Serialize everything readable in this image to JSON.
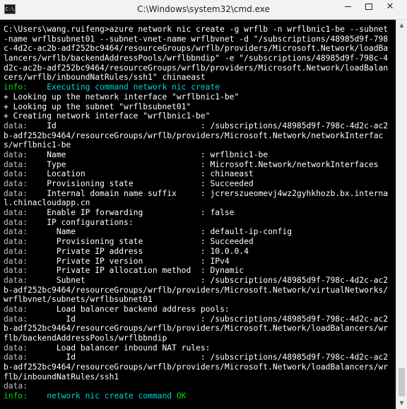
{
  "window": {
    "title": "C:\\Windows\\system32\\cmd.exe",
    "icon_label": "C:\\",
    "controls": {
      "minimize": "minimize",
      "maximize": "maximize",
      "close": "✕"
    }
  },
  "console": {
    "lines": [
      {
        "prefix": "",
        "text": "C:\\Users\\wang.ruifeng>azure network nic create -g wrflb -n wrflbnic1-be --subnet"
      },
      {
        "prefix": "",
        "text": "-name wrflbsubnet01 --subnet-vnet-name wrflbvnet -d \"/subscriptions/48985d9f-798"
      },
      {
        "prefix": "",
        "text": "c-4d2c-ac2b-adf252bc9464/resourceGroups/wrflb/providers/Microsoft.Network/loadBa"
      },
      {
        "prefix": "",
        "text": "lancers/wrflb/backendAddressPools/wrflbbndip\" -e \"/subscriptions/48985d9f-798c-4"
      },
      {
        "prefix": "",
        "text": "d2c-ac2b-adf252bc9464/resourceGroups/wrflb/providers/Microsoft.Network/loadBalan"
      },
      {
        "prefix": "",
        "text": "cers/wrflb/inboundNatRules/ssh1\" chinaeast"
      },
      {
        "prefix": "info:",
        "text": "    Executing command network nic create"
      },
      {
        "prefix": "",
        "text": "+ Looking up the network interface \"wrflbnic1-be\""
      },
      {
        "prefix": "",
        "text": "+ Looking up the subnet \"wrflbsubnet01\""
      },
      {
        "prefix": "",
        "text": "+ Creating network interface \"wrflbnic1-be\""
      },
      {
        "prefix": "data:",
        "text": "    Id                              : /subscriptions/48985d9f-798c-4d2c-ac2"
      },
      {
        "prefix": "",
        "text": "b-adf252bc9464/resourceGroups/wrflb/providers/Microsoft.Network/networkInterfac"
      },
      {
        "prefix": "",
        "text": "s/wrflbnic1-be"
      },
      {
        "prefix": "data:",
        "text": "    Name                            : wrflbnic1-be"
      },
      {
        "prefix": "data:",
        "text": "    Type                            : Microsoft.Network/networkInterfaces"
      },
      {
        "prefix": "data:",
        "text": "    Location                        : chinaeast"
      },
      {
        "prefix": "data:",
        "text": "    Provisioning state              : Succeeded"
      },
      {
        "prefix": "data:",
        "text": "    Internal domain name suffix     : jcrerszueomevj4wz2gyhkhozb.bx.interna"
      },
      {
        "prefix": "",
        "text": "l.chinacloudapp.cn"
      },
      {
        "prefix": "data:",
        "text": "    Enable IP forwarding            : false"
      },
      {
        "prefix": "data:",
        "text": "    IP configurations:"
      },
      {
        "prefix": "data:",
        "text": "      Name                          : default-ip-config"
      },
      {
        "prefix": "data:",
        "text": "      Provisioning state            : Succeeded"
      },
      {
        "prefix": "data:",
        "text": "      Private IP address            : 10.0.0.4"
      },
      {
        "prefix": "data:",
        "text": "      Private IP version            : IPv4"
      },
      {
        "prefix": "data:",
        "text": "      Private IP allocation method  : Dynamic"
      },
      {
        "prefix": "data:",
        "text": "      Subnet                        : /subscriptions/48985d9f-798c-4d2c-ac2"
      },
      {
        "prefix": "",
        "text": "b-adf252bc9464/resourceGroups/wrflb/providers/Microsoft.Network/virtualNetworks/"
      },
      {
        "prefix": "",
        "text": "wrflbvnet/subnets/wrflbsubnet01"
      },
      {
        "prefix": "data:",
        "text": "      Load balancer backend address pools:"
      },
      {
        "prefix": "data:",
        "text": "        Id                          : /subscriptions/48985d9f-798c-4d2c-ac2"
      },
      {
        "prefix": "",
        "text": "b-adf252bc9464/resourceGroups/wrflb/providers/Microsoft.Network/loadBalancers/wr"
      },
      {
        "prefix": "",
        "text": "flb/backendAddressPools/wrflbbndip"
      },
      {
        "prefix": "data:",
        "text": "      Load balancer inbound NAT rules:"
      },
      {
        "prefix": "data:",
        "text": "        Id                          : /subscriptions/48985d9f-798c-4d2c-ac2"
      },
      {
        "prefix": "",
        "text": "b-adf252bc9464/resourceGroups/wrflb/providers/Microsoft.Network/loadBalancers/wr"
      },
      {
        "prefix": "",
        "text": "flb/inboundNatRules/ssh1"
      },
      {
        "prefix": "data:",
        "text": ""
      },
      {
        "prefix": "info:",
        "text": "    network nic create command ",
        "suffix": "OK"
      }
    ]
  },
  "colors": {
    "background": "#000000",
    "command_text": "#ffffff",
    "output_text": "#c0c0c0",
    "info_prefix": "#00e000",
    "data_prefix": "#c0c0c0",
    "info_message": "#00d7d7",
    "ok": "#00e000"
  },
  "scrollbar": {
    "up": "▲",
    "down": "▼"
  }
}
